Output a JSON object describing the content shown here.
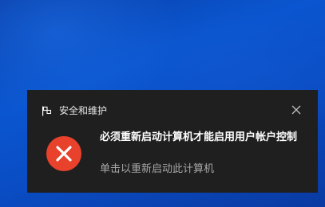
{
  "notification": {
    "app_name": "安全和维护",
    "app_icon": "security-maintenance-flag-icon",
    "title": "必须重新启动计算机才能启用用户帐户控制",
    "body": "单击以重新启动此计算机",
    "status_icon": "error-x-icon",
    "close_icon": "close-icon"
  },
  "colors": {
    "toast_bg": "#1f1f1f",
    "error_red": "#e8412c",
    "desktop_blue": "#0a4cc3",
    "body_text": "#a8a8a8"
  }
}
